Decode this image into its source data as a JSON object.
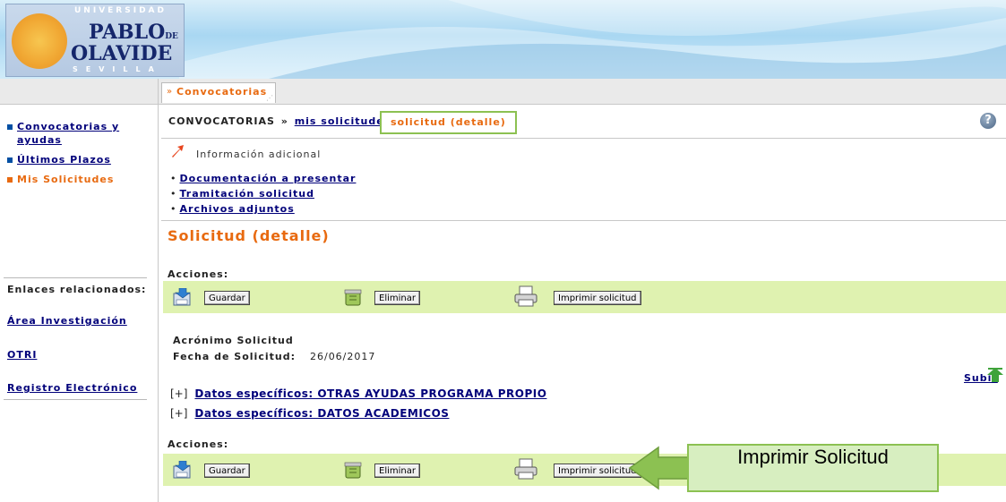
{
  "header": {
    "university_top": "UNIVERSIDAD",
    "logo_line1": "PABLO",
    "logo_de": "DE",
    "logo_line2": "OLAVIDE",
    "logo_city": "SEVILLA"
  },
  "tab": {
    "label": "Convocatorias"
  },
  "sidebar": {
    "items": [
      {
        "label": "Convocatorias y ayudas",
        "active": false
      },
      {
        "label": "Últimos Plazos",
        "active": false
      },
      {
        "label": "Mis Solicitudes",
        "active": true
      }
    ],
    "related_title": "Enlaces relacionados:",
    "related_links": [
      "Área Investigación",
      "OTRI",
      "Registro Electrónico"
    ]
  },
  "breadcrumb": {
    "root": "CONVOCATORIAS",
    "separator": "»",
    "link": "mis solicitudes",
    "current": "solicitud (detalle)"
  },
  "help_glyph": "?",
  "info": {
    "label": "Información adicional",
    "links": [
      "Documentación a presentar",
      "Tramitación solicitud",
      "Archivos adjuntos"
    ]
  },
  "page_title": "Solicitud (detalle)",
  "actions": {
    "label": "Acciones:",
    "save": "Guardar",
    "delete": "Eliminar",
    "print": "Imprimir solicitud"
  },
  "fields": {
    "acronym_label": "Acrónimo Solicitud",
    "date_label": "Fecha de Solicitud:",
    "date_value": "26/06/2017"
  },
  "subir": "Subir",
  "sections": [
    {
      "toggle": "[+]",
      "label": "Datos específicos: OTRAS AYUDAS PROGRAMA PROPIO"
    },
    {
      "toggle": "[+]",
      "label": "Datos específicos: DATOS ACADEMICOS"
    }
  ],
  "callout": {
    "text": "Imprimir Solicitud"
  },
  "colors": {
    "accent_orange": "#e86a10",
    "link_blue": "#00007a",
    "action_bar": "#dff2b0",
    "callout_green": "#8cc152"
  }
}
